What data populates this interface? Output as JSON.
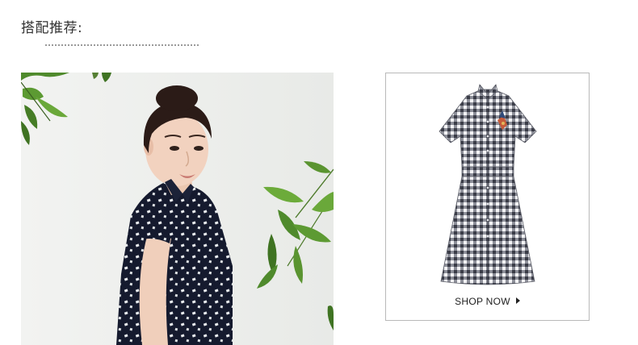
{
  "section": {
    "title": "搭配推荐:"
  },
  "product": {
    "cta_label": "SHOP NOW",
    "cta_icon": "triangle-right-icon",
    "dress_pattern": "gingham-check",
    "dress_color": "#4a4a55"
  },
  "photo": {
    "subject": "model-in-navy-print-dress",
    "bg_color": "#eef0ee"
  }
}
